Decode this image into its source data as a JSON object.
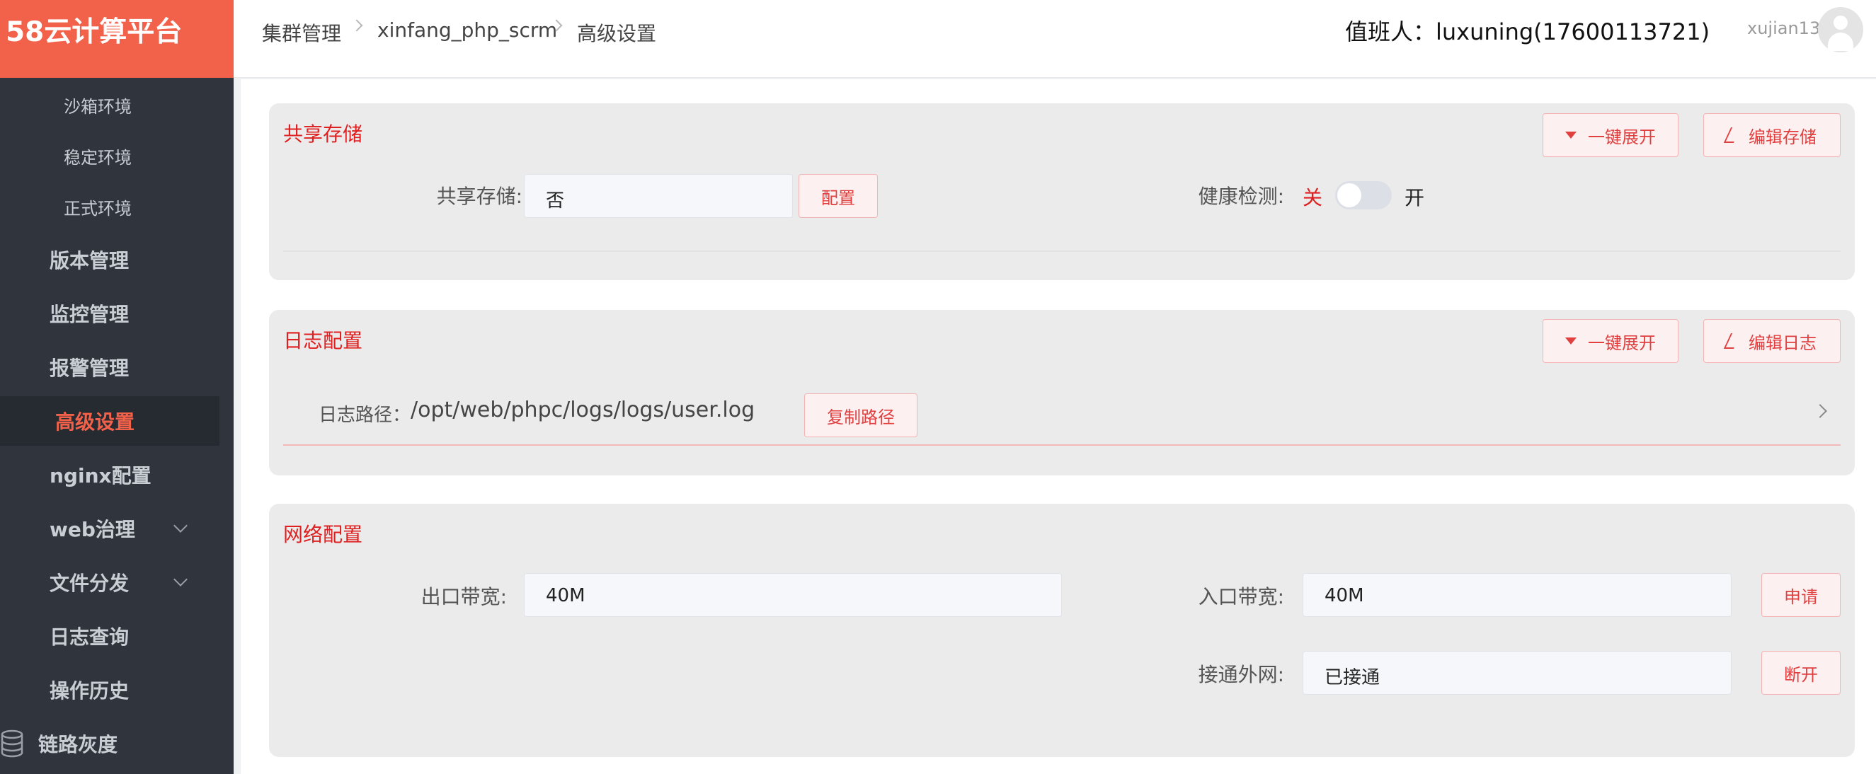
{
  "app": {
    "title": "58云计算平台"
  },
  "sidebar": {
    "sub_items": [
      {
        "label": "沙箱环境"
      },
      {
        "label": "稳定环境"
      },
      {
        "label": "正式环境"
      }
    ],
    "items": [
      {
        "label": "版本管理"
      },
      {
        "label": "监控管理"
      },
      {
        "label": "报警管理"
      },
      {
        "label": "高级设置",
        "active": true
      },
      {
        "label": "nginx配置"
      },
      {
        "label": "web治理",
        "expandable": true
      },
      {
        "label": "文件分发",
        "expandable": true
      },
      {
        "label": "日志查询"
      },
      {
        "label": "操作历史"
      },
      {
        "label": "链路灰度",
        "icon": "database-icon"
      }
    ]
  },
  "header": {
    "breadcrumb": [
      "集群管理",
      "xinfang_php_scrm",
      "高级设置"
    ],
    "duty": "值班人：luxuning(17600113721)",
    "user": "xujian13"
  },
  "shared_storage": {
    "title": "共享存储",
    "expand_label": "一键展开",
    "edit_label": "编辑存储",
    "storage_label": "共享存储:",
    "storage_value": "否",
    "config_label": "配置",
    "health_label": "健康检测:",
    "health_off": "关",
    "health_on": "开",
    "health_enabled": false
  },
  "log_config": {
    "title": "日志配置",
    "expand_label": "一键展开",
    "edit_label": "编辑日志",
    "path_label": "日志路径：",
    "path_value": "/opt/web/phpc/logs/logs/user.log",
    "copy_label": "复制路径"
  },
  "network": {
    "title": "网络配置",
    "egress_label": "出口带宽:",
    "egress_value": "40M",
    "ingress_label": "入口带宽:",
    "ingress_value": "40M",
    "apply_label": "申请",
    "external_label": "接通外网:",
    "external_value": "已接通",
    "disconnect_label": "断开"
  },
  "colors": {
    "brand": "#f2614a",
    "sidebar_bg": "#2f343d",
    "accent_red": "#e02020"
  }
}
